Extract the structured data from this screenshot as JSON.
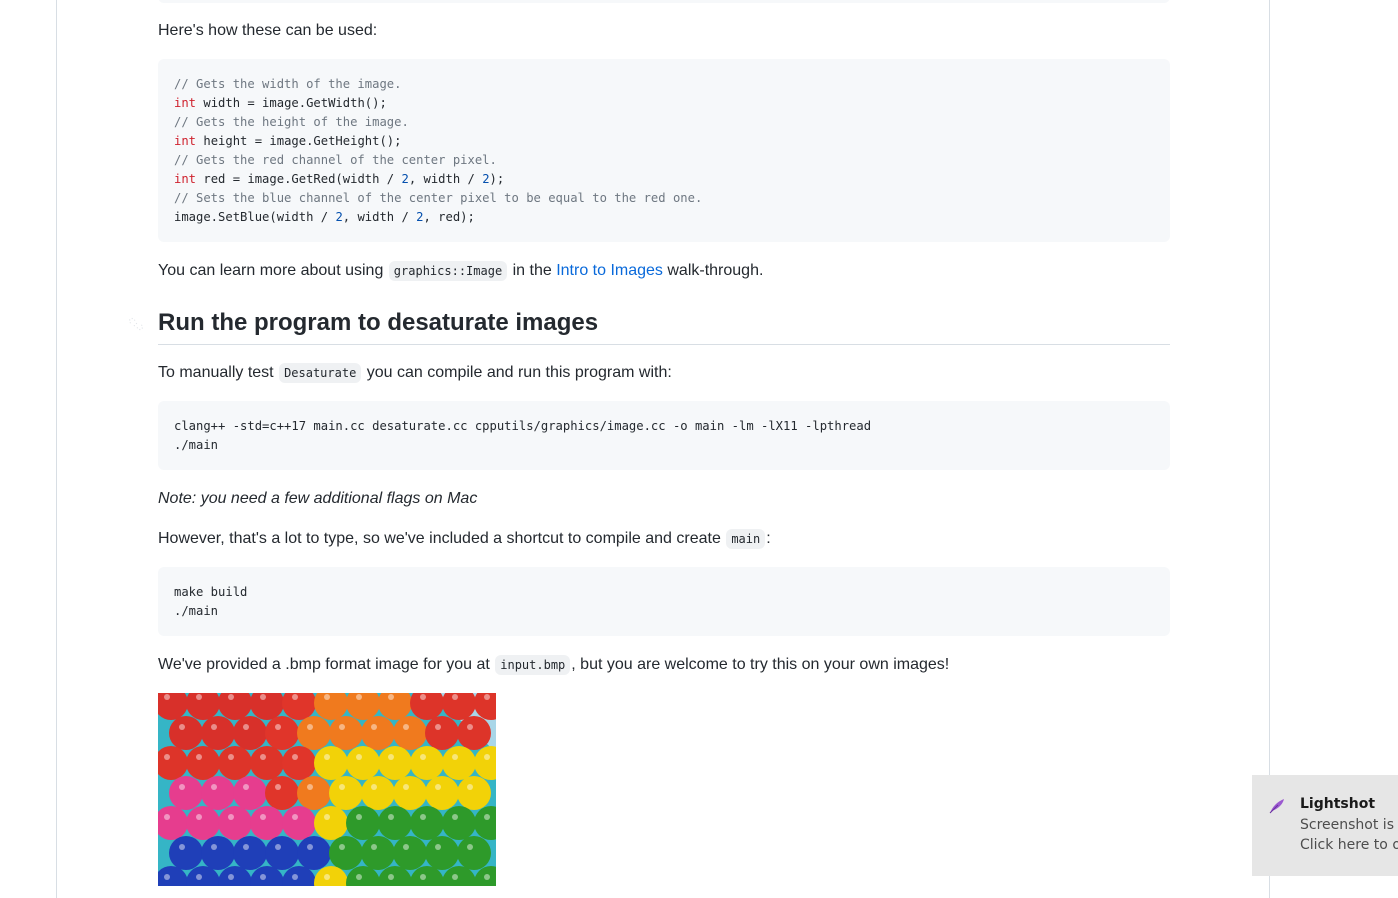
{
  "paragraphs": {
    "usage_intro": "Here's how these can be used:",
    "learn_more_prefix": "You can learn more about using ",
    "learn_more_code": "graphics::Image",
    "learn_more_mid": " in the ",
    "learn_more_link": "Intro to Images",
    "learn_more_suffix": " walk-through.",
    "manual_test_prefix": "To manually test ",
    "manual_test_code": "Desaturate",
    "manual_test_suffix": " you can compile and run this program with:",
    "note": "Note: you need a few additional flags on Mac",
    "shortcut_prefix": "However, that's a lot to type, so we've included a shortcut to compile and create ",
    "shortcut_code": "main",
    "shortcut_suffix": ":",
    "provided_prefix": "We've provided a .bmp format image for you at ",
    "provided_code": "input.bmp",
    "provided_suffix": ", but you are welcome to try this on your own images!"
  },
  "heading": {
    "title": "Run the program to desaturate images",
    "anchor_icon": "link-icon"
  },
  "code_usage": {
    "lines": [
      {
        "comment": "// Gets the width of the image."
      },
      {
        "kw": "int",
        "text": " width = image.GetWidth();"
      },
      {
        "comment": "// Gets the height of the image."
      },
      {
        "kw": "int",
        "text": " height = image.GetHeight();"
      },
      {
        "comment": "// Gets the red channel of the center pixel."
      },
      {
        "kw": "int",
        "text_a": " red = image.GetRed(width / ",
        "num1": "2",
        "text_b": ", width / ",
        "num2": "2",
        "text_c": ");"
      },
      {
        "comment": "// Sets the blue channel of the center pixel to be equal to the red one."
      },
      {
        "text_a": "image.SetBlue(width / ",
        "num1": "2",
        "text_b": ", width / ",
        "num2": "2",
        "text_c": ", red);"
      }
    ]
  },
  "code_compile": {
    "line1": "clang++ -std=c++17 main.cc desaturate.cc cpputils/graphics/image.cc -o main -lm -lX11 -lpthread",
    "line2": "./main"
  },
  "code_make": {
    "line1": "make build",
    "line2": "./main"
  },
  "image": {
    "alt": "Colorful ball pit with red, orange, yellow, pink, green and blue balls"
  },
  "toast": {
    "app": "Lightshot",
    "line1": "Screenshot is s",
    "line2": "Click here to op",
    "icon": "feather-icon"
  },
  "colors": {
    "link": "#0969da",
    "keyword": "#cf222e",
    "number": "#0550ae",
    "comment": "#6e7781",
    "code_bg": "#f6f8fa",
    "toast_bg": "#e6e6e6"
  }
}
